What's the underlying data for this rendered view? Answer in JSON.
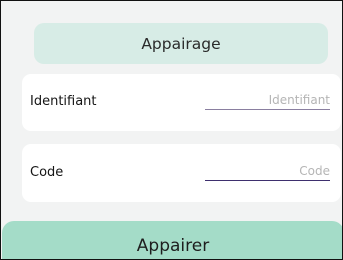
{
  "header": {
    "title": "Appairage"
  },
  "form": {
    "identifiant": {
      "label": "Identifiant",
      "value": "",
      "placeholder": "Identifiant"
    },
    "code": {
      "label": "Code",
      "value": "",
      "placeholder": "Code"
    }
  },
  "actions": {
    "submit_label": "Appairer"
  },
  "colors": {
    "background": "#f2f3f3",
    "header_fill": "#d7ece6",
    "button_fill": "#a4dcc8",
    "card_fill": "#ffffff"
  }
}
